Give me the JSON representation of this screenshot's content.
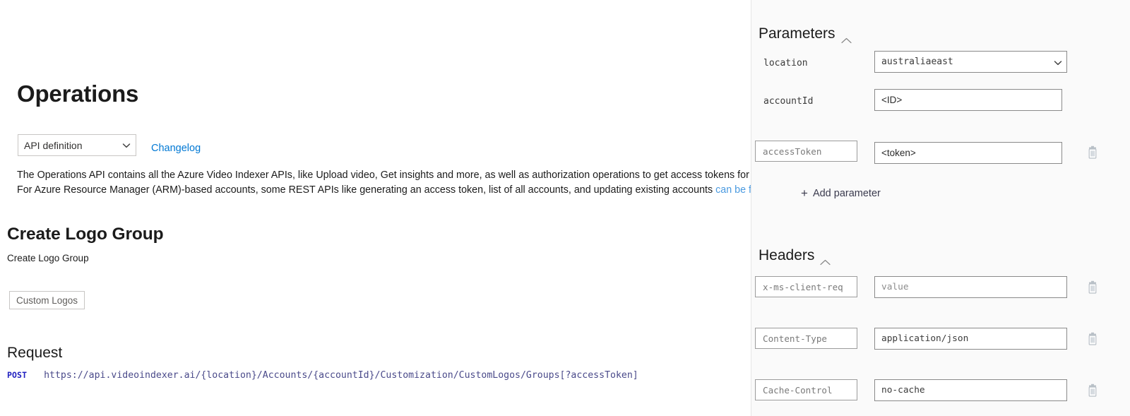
{
  "doc": {
    "page_title": "Operations",
    "api_definition_select": {
      "selected": "API definition",
      "options": [
        "API definition"
      ]
    },
    "changelog_link": "Changelog",
    "intro_line_1": "The Operations API contains all the Azure Video Indexer APIs, like Upload video, Get insights and more, as well as authorization operations to get access tokens for ca",
    "intro_line_2_before": "For Azure Resource Manager (ARM)-based accounts, some REST APIs like generating an access token, list of all accounts, and updating existing accounts ",
    "intro_line_2_link": "can be found",
    "operation_title": "Create Logo Group",
    "operation_description": "Create Logo Group",
    "tag_button": "Custom Logos",
    "request_heading": "Request",
    "request_method": "POST",
    "request_url": "https://api.videoindexer.ai/{location}/Accounts/{accountId}/Customization/CustomLogos/Groups[?accessToken]"
  },
  "panel": {
    "parameters": {
      "heading": "Parameters",
      "collapse_icon": "chevron-up-icon",
      "add_label": "Add parameter",
      "add_icon": "plus-icon",
      "items": [
        {
          "name": "location",
          "name_editable": false,
          "control": "select",
          "value": "australiaeast",
          "options": [
            "australiaeast"
          ],
          "deletable": false
        },
        {
          "name": "accountId",
          "name_editable": false,
          "control": "text",
          "value": "<ID>",
          "deletable": false
        },
        {
          "name": "accessToken",
          "name_editable": true,
          "control": "text",
          "value": "<token>",
          "deletable": true,
          "delete_icon": "trash-icon"
        }
      ]
    },
    "headers": {
      "heading": "Headers",
      "collapse_icon": "chevron-up-icon",
      "items": [
        {
          "name": "x-ms-client-req",
          "value": "",
          "value_placeholder": "value",
          "deletable": true,
          "delete_icon": "trash-icon"
        },
        {
          "name": "Content-Type",
          "value": "application/json",
          "value_placeholder": "value",
          "deletable": true,
          "delete_icon": "trash-icon"
        },
        {
          "name": "Cache-Control",
          "value": "no-cache",
          "value_placeholder": "value",
          "deletable": true,
          "delete_icon": "trash-icon"
        }
      ]
    }
  },
  "colors": {
    "link": "#0078d4",
    "inline_link": "#4a9ae0",
    "method": "#2020c0",
    "panel_bg": "#fafafa"
  }
}
